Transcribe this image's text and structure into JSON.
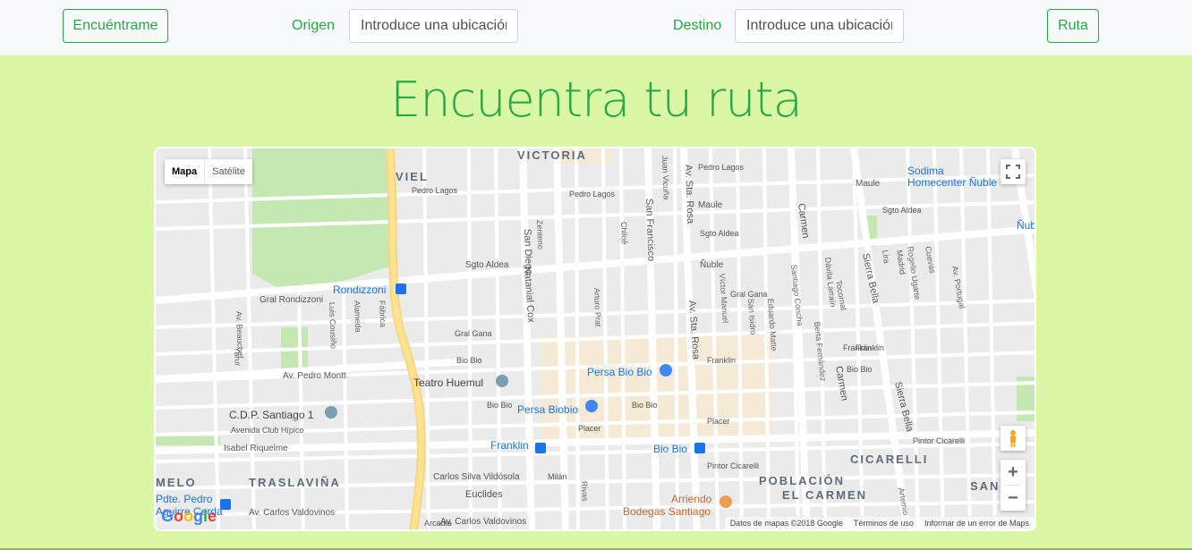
{
  "nav": {
    "find_me_label": "Encuéntrame",
    "origin_label": "Origen",
    "origin_placeholder": "Introduce una ubicación",
    "destination_label": "Destino",
    "destination_placeholder": "Introduce una ubicación",
    "route_label": "Ruta"
  },
  "title": "Encuentra tu ruta",
  "map": {
    "type_map": "Mapa",
    "type_satellite": "Satélite",
    "zoom_in": "+",
    "zoom_out": "−",
    "google_logo": "Google",
    "footer_data": "Datos de mapas ©2018 Google",
    "footer_terms": "Términos de uso",
    "footer_report": "Informar de un error de Maps",
    "districts": [
      "VICTORIA",
      "VIEL",
      "CICARELLI",
      "POBLACIÓN",
      "EL CARMEN",
      "TRASLAVIÑA",
      "MELO",
      "SAN"
    ],
    "places": [
      "Rondizzoni",
      "Teatro Huemul",
      "C.D.P. Santiago 1",
      "Persa Bio Bio",
      "Persa Biobio",
      "Franklin",
      "Bio Bio",
      "Arriendo",
      "Bodegas Santiago",
      "Sodima",
      "Homecenter Ñuble",
      "Ñuble",
      "Pdte. Pedro",
      "Aguirre Cerda"
    ],
    "streets": [
      "Gral Rondizzoni",
      "Av. Pedro Montt",
      "Isabel Riquelme",
      "Avenida Club Hípico",
      "Av. Carlos Valdovinos",
      "Sgto Aldea",
      "Nataniel Cox",
      "San Diego",
      "San Francisco",
      "Av. Sta. Rosa",
      "Maule",
      "Carmen",
      "Sierra Bella",
      "Pedro Lagos",
      "Gral Gana",
      "Franklin",
      "Bio Bio",
      "Placer",
      "Pintor Cicarelli",
      "Carlos Silva Vildósola",
      "Euclides",
      "Milán",
      "Arcadia",
      "Rivas",
      "Arturo Prat",
      "Av. Beauchef",
      "Yarur",
      "Alameda",
      "Fábrica",
      "Luis Cousiño",
      "Víctor Manuel",
      "San Isidro",
      "Eduardo Matte",
      "Berta Fernández",
      "Santiago Concha",
      "Dávila Larraín",
      "Lira",
      "Madrid",
      "Rogelio Ugarte",
      "Cuevas",
      "Av. Portugal",
      "Tocornal",
      "Sta María",
      "Zenteno",
      "Chiloé",
      "Juan Vicuña",
      "Sgto Aldea",
      "Arauco",
      "Ing Obrecht",
      "Sta Elena",
      "Artemio",
      "Orán"
    ]
  }
}
